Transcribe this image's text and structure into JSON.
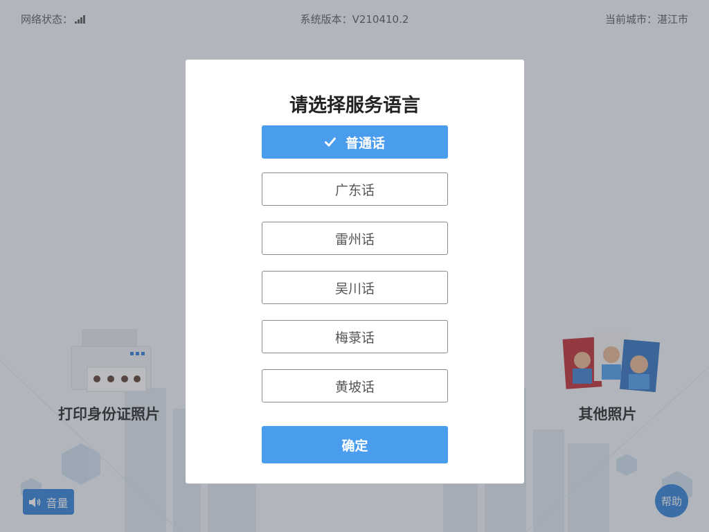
{
  "status_bar": {
    "network_label": "网络状态：",
    "network_icon": "signal-bars-icon",
    "version_label": "系统版本：V210410.2",
    "city_label": "当前城市：湛江市"
  },
  "cards": {
    "print_id_label": "打印身份证照片",
    "other_photos_label": "其他照片"
  },
  "volume_button": {
    "label": "音量",
    "icon": "speaker-icon"
  },
  "help_button": {
    "label": "帮助"
  },
  "modal": {
    "title": "请选择服务语言",
    "options": [
      {
        "label": "普通话",
        "selected": true
      },
      {
        "label": "广东话",
        "selected": false
      },
      {
        "label": "雷州话",
        "selected": false
      },
      {
        "label": "吴川话",
        "selected": false
      },
      {
        "label": "梅菉话",
        "selected": false
      },
      {
        "label": "黄坡话",
        "selected": false
      }
    ],
    "confirm_label": "确定"
  },
  "colors": {
    "accent": "#4a9ded",
    "button_dark": "#2d7ed6",
    "overlay": "rgba(80,86,96,0.40)"
  }
}
